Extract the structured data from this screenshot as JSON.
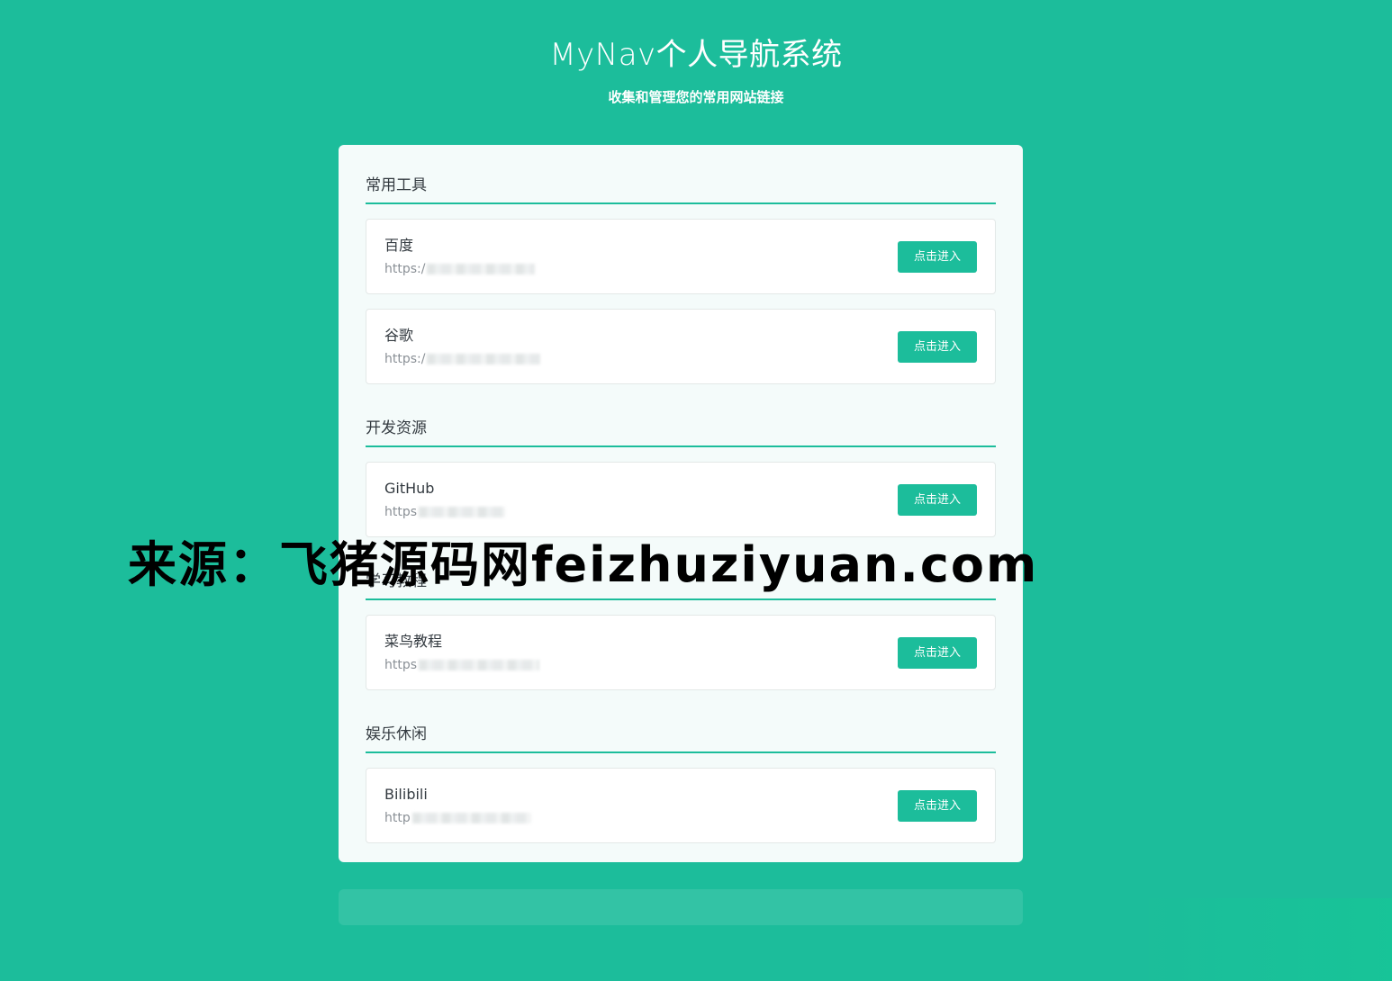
{
  "header": {
    "title": "MyNav个人导航系统",
    "subtitle": "收集和管理您的常用网站链接"
  },
  "sections": [
    {
      "title": "常用工具",
      "items": [
        {
          "name": "百度",
          "url_prefix": "https:/"
        },
        {
          "name": "谷歌",
          "url_prefix": "https:/"
        }
      ]
    },
    {
      "title": "开发资源",
      "items": [
        {
          "name": "GitHub",
          "url_prefix": "https"
        }
      ]
    },
    {
      "title": "学习教程",
      "items": [
        {
          "name": "菜鸟教程",
          "url_prefix": "https"
        }
      ]
    },
    {
      "title": "娱乐休闲",
      "items": [
        {
          "name": "Bilibili",
          "url_prefix": "http"
        }
      ]
    }
  ],
  "button_label": "点击进入",
  "watermark": "来源：飞猪源码网feizhuziyuan.com",
  "colors": {
    "background": "#1cbd9b",
    "card": "#f4fbfa",
    "accent": "#1cbd9b",
    "text": "#333a40"
  }
}
